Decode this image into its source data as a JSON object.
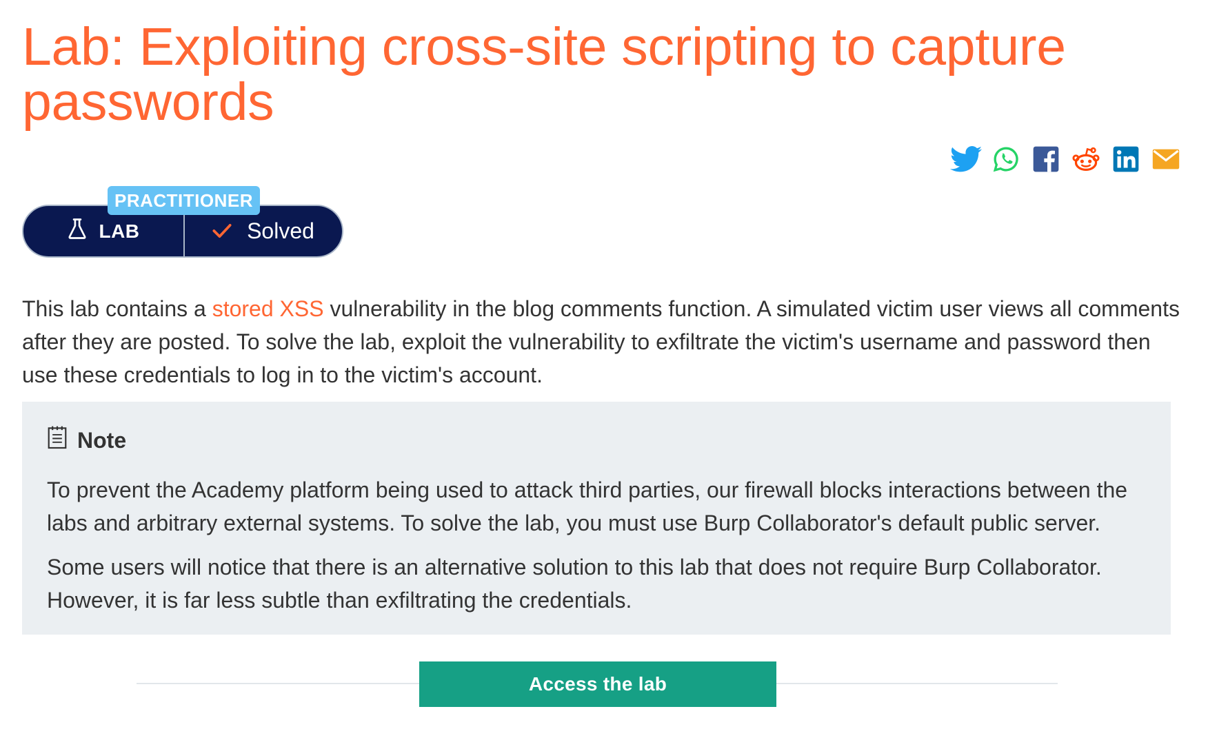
{
  "title": "Lab: Exploiting cross-site scripting to capture passwords",
  "share": {
    "icons": [
      "twitter-icon",
      "whatsapp-icon",
      "facebook-icon",
      "reddit-icon",
      "linkedin-icon",
      "email-icon"
    ]
  },
  "badge": {
    "level": "PRACTITIONER",
    "lab_label": "LAB",
    "status": "Solved"
  },
  "description": {
    "before_link": "This lab contains a ",
    "link_text": "stored XSS",
    "after_link": " vulnerability in the blog comments function. A simulated victim user views all comments after they are posted. To solve the lab, exploit the vulnerability to exfiltrate the victim's username and password then use these credentials to log in to the victim's account."
  },
  "note": {
    "heading": "Note",
    "paragraph1": "To prevent the Academy platform being used to attack third parties, our firewall blocks interactions between the labs and arbitrary external systems. To solve the lab, you must use Burp Collaborator's default public server.",
    "paragraph2": "Some users will notice that there is an alternative solution to this lab that does not require Burp Collaborator. However, it is far less subtle than exfiltrating the credentials."
  },
  "access_button": "Access the lab",
  "colors": {
    "accent": "#ff6633",
    "badge_navy": "#0a1850",
    "level_blue": "#66c2f5",
    "button_green": "#16a085",
    "note_bg": "#ebeff2"
  }
}
